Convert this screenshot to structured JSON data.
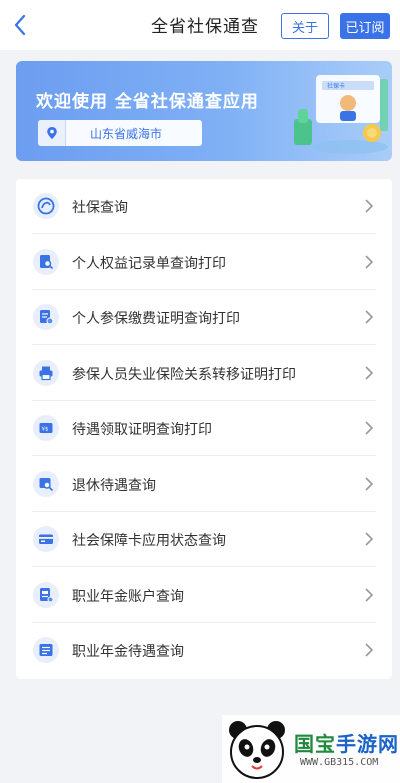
{
  "nav": {
    "title": "全省社保通查",
    "about_label": "关于",
    "subscribed_label": "已订阅"
  },
  "banner": {
    "title": "欢迎使用 全省社保通查应用",
    "location": "山东省威海市",
    "card_label": "社保卡"
  },
  "menu": {
    "items": [
      {
        "label": "社保查询",
        "icon": "social-security-logo-icon"
      },
      {
        "label": "个人权益记录单查询打印",
        "icon": "document-search-icon"
      },
      {
        "label": "个人参保缴费证明查询打印",
        "icon": "payment-certificate-icon"
      },
      {
        "label": "参保人员失业保险关系转移证明打印",
        "icon": "printer-icon"
      },
      {
        "label": "待遇领取证明查询打印",
        "icon": "benefit-certificate-icon"
      },
      {
        "label": "退休待遇查询",
        "icon": "retirement-search-icon"
      },
      {
        "label": "社会保障卡应用状态查询",
        "icon": "card-icon"
      },
      {
        "label": "职业年金账户查询",
        "icon": "account-icon"
      },
      {
        "label": "职业年金待遇查询",
        "icon": "annuity-icon"
      }
    ]
  },
  "watermark": {
    "brand_a": "国宝",
    "brand_b": "手游网",
    "url": "WWW.GB315.COM"
  },
  "colors": {
    "accent": "#3a73e8",
    "background": "#f2f3f7",
    "watermark_green": "#1f8a3b"
  }
}
